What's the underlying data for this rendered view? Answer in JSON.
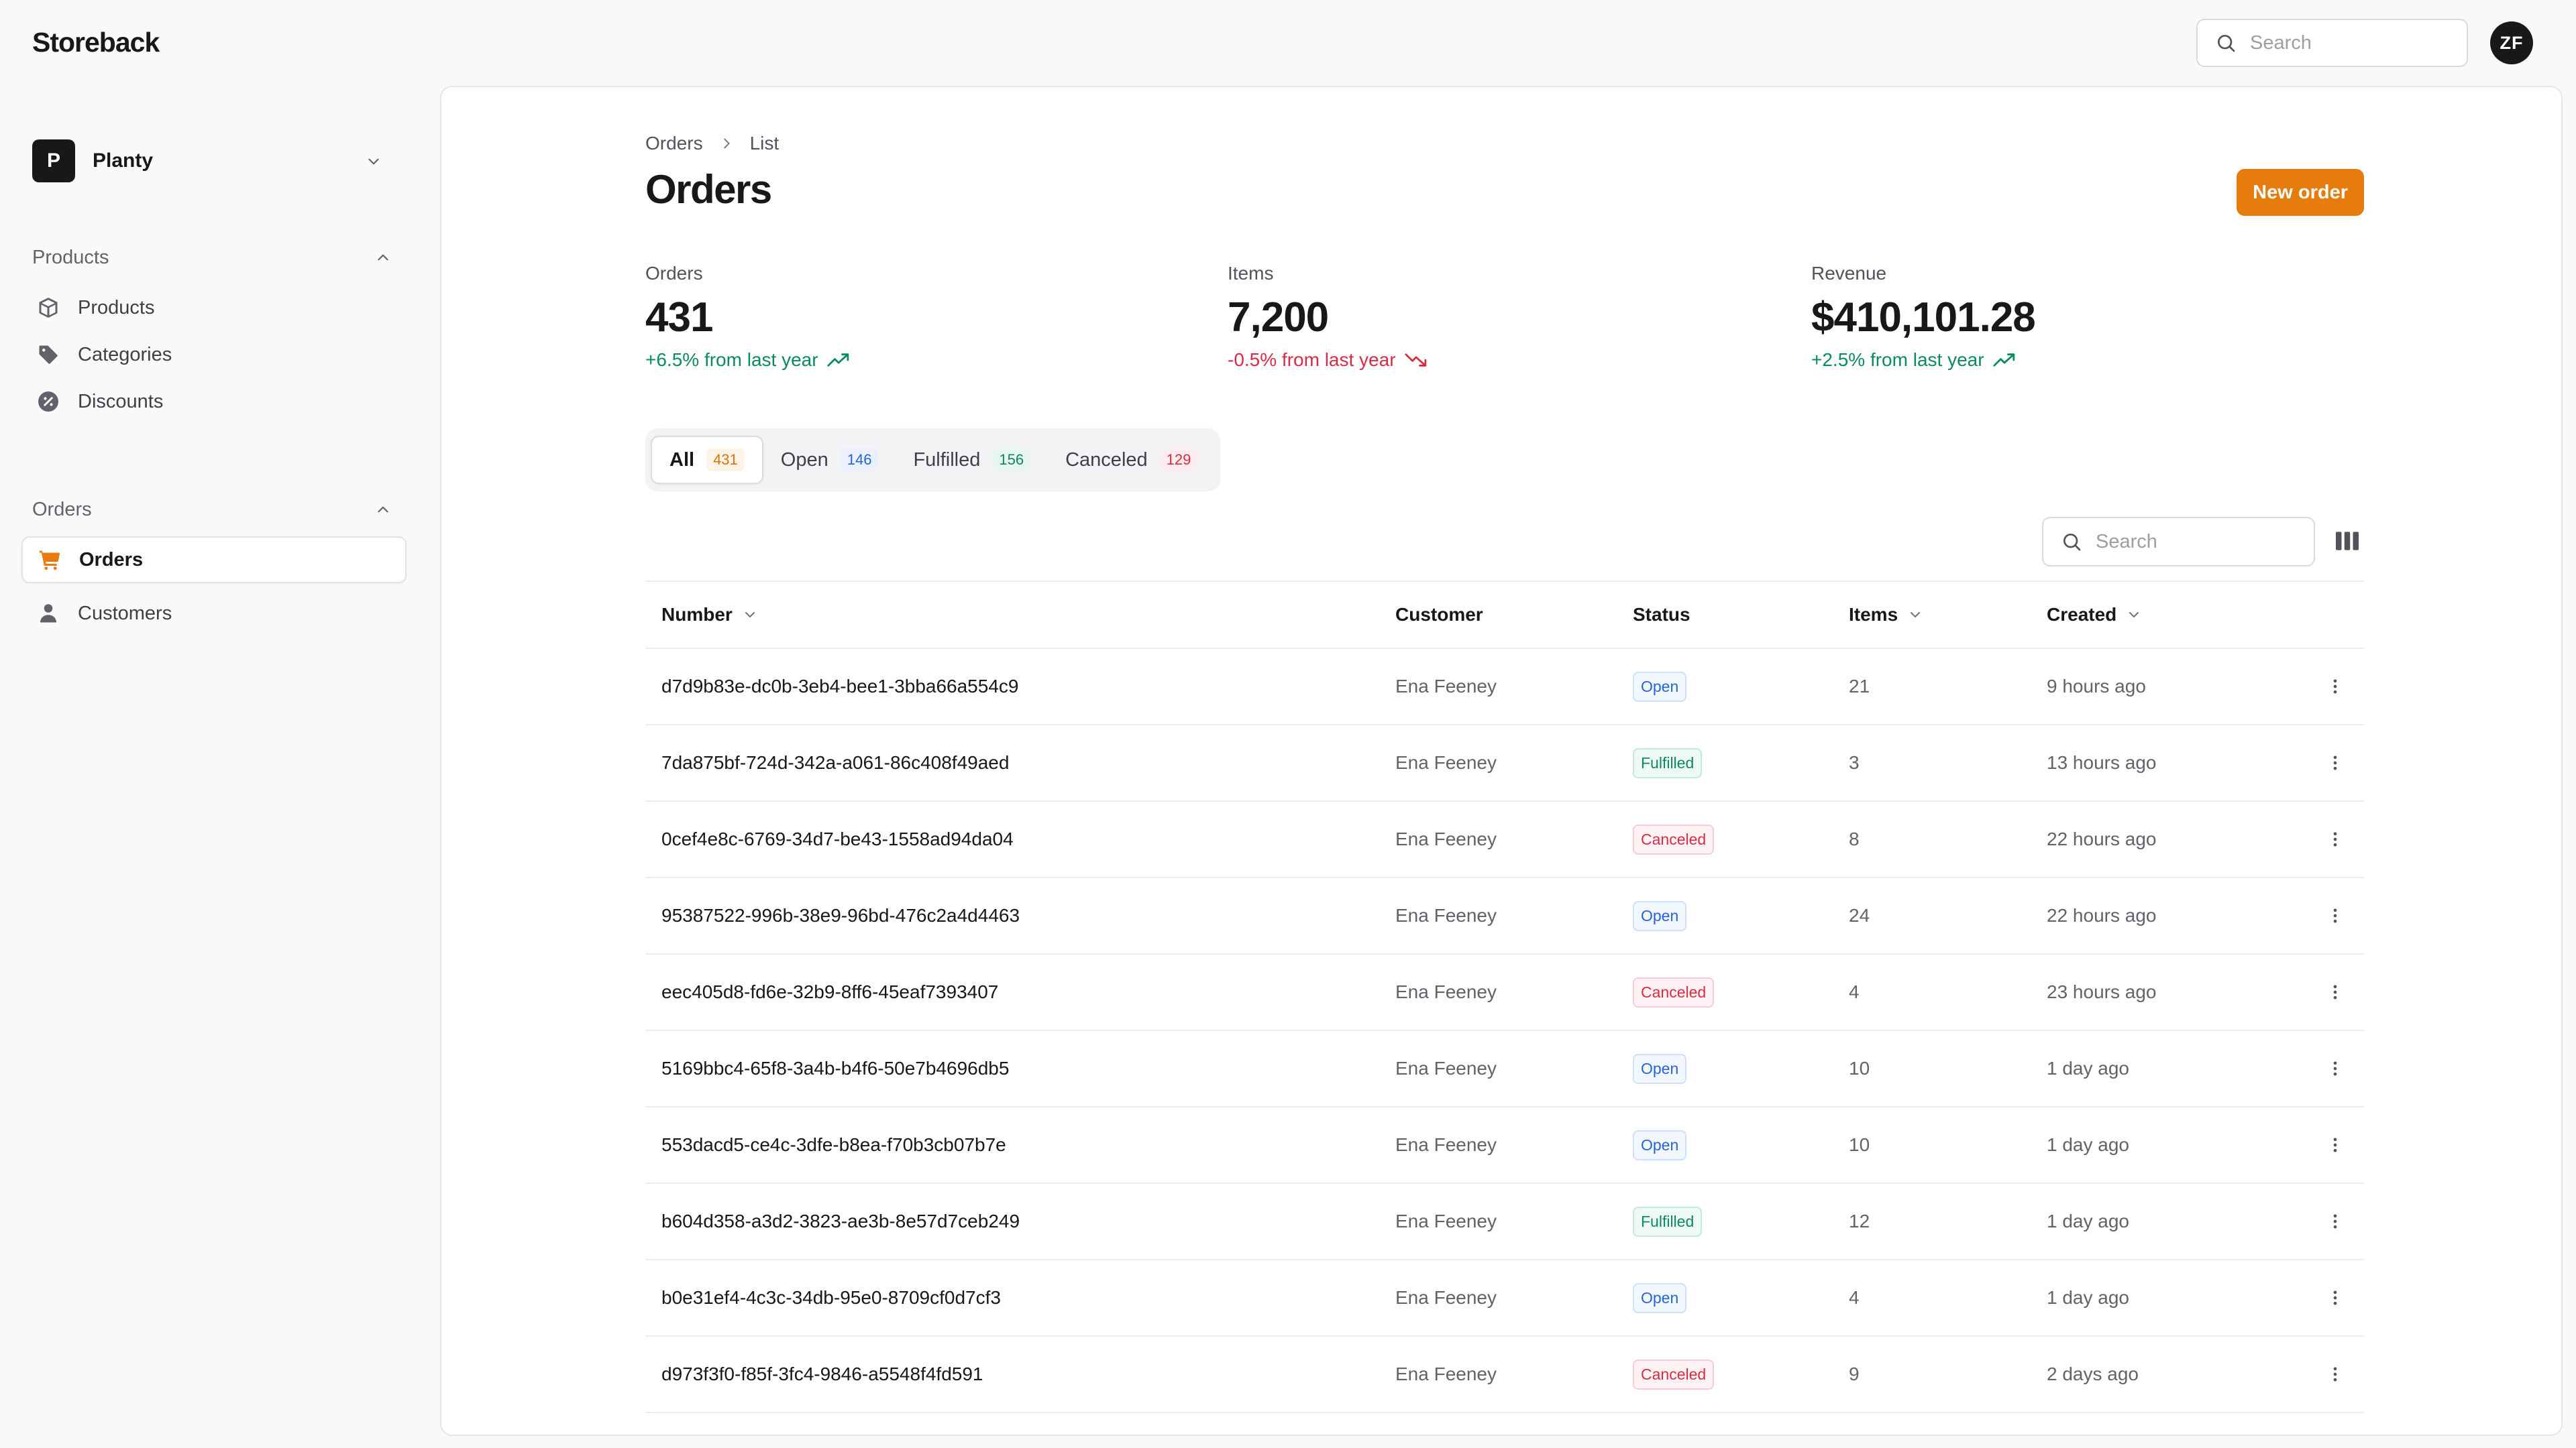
{
  "app": {
    "brand": "Storeback"
  },
  "header": {
    "search_placeholder": "Search",
    "user_initials": "ZF"
  },
  "store": {
    "badge": "P",
    "name": "Planty"
  },
  "sidebar": {
    "sections": [
      {
        "heading": "Products",
        "items": [
          {
            "label": "Products",
            "icon": "box-icon"
          },
          {
            "label": "Categories",
            "icon": "tag-icon"
          },
          {
            "label": "Discounts",
            "icon": "discount-icon"
          }
        ]
      },
      {
        "heading": "Orders",
        "items": [
          {
            "label": "Orders",
            "icon": "cart-icon",
            "active": true
          },
          {
            "label": "Customers",
            "icon": "user-icon"
          }
        ]
      }
    ]
  },
  "page": {
    "breadcrumb": [
      "Orders",
      "List"
    ],
    "title": "Orders",
    "new_order_label": "New order"
  },
  "stats": [
    {
      "label": "Orders",
      "value": "431",
      "trend": "+6.5% from last year",
      "direction": "up"
    },
    {
      "label": "Items",
      "value": "7,200",
      "trend": "-0.5% from last year",
      "direction": "down"
    },
    {
      "label": "Revenue",
      "value": "$410,101.28",
      "trend": "+2.5% from last year",
      "direction": "up"
    }
  ],
  "tabs": [
    {
      "label": "All",
      "count": "431",
      "active": true
    },
    {
      "label": "Open",
      "count": "146"
    },
    {
      "label": "Fulfilled",
      "count": "156"
    },
    {
      "label": "Canceled",
      "count": "129"
    }
  ],
  "table": {
    "search_placeholder": "Search",
    "columns": {
      "number": "Number",
      "customer": "Customer",
      "status": "Status",
      "items": "Items",
      "created": "Created"
    },
    "rows": [
      {
        "number": "d7d9b83e-dc0b-3eb4-bee1-3bba66a554c9",
        "customer": "Ena Feeney",
        "status": "Open",
        "items": "21",
        "created": "9 hours ago"
      },
      {
        "number": "7da875bf-724d-342a-a061-86c408f49aed",
        "customer": "Ena Feeney",
        "status": "Fulfilled",
        "items": "3",
        "created": "13 hours ago"
      },
      {
        "number": "0cef4e8c-6769-34d7-be43-1558ad94da04",
        "customer": "Ena Feeney",
        "status": "Canceled",
        "items": "8",
        "created": "22 hours ago"
      },
      {
        "number": "95387522-996b-38e9-96bd-476c2a4d4463",
        "customer": "Ena Feeney",
        "status": "Open",
        "items": "24",
        "created": "22 hours ago"
      },
      {
        "number": "eec405d8-fd6e-32b9-8ff6-45eaf7393407",
        "customer": "Ena Feeney",
        "status": "Canceled",
        "items": "4",
        "created": "23 hours ago"
      },
      {
        "number": "5169bbc4-65f8-3a4b-b4f6-50e7b4696db5",
        "customer": "Ena Feeney",
        "status": "Open",
        "items": "10",
        "created": "1 day ago"
      },
      {
        "number": "553dacd5-ce4c-3dfe-b8ea-f70b3cb07b7e",
        "customer": "Ena Feeney",
        "status": "Open",
        "items": "10",
        "created": "1 day ago"
      },
      {
        "number": "b604d358-a3d2-3823-ae3b-8e57d7ceb249",
        "customer": "Ena Feeney",
        "status": "Fulfilled",
        "items": "12",
        "created": "1 day ago"
      },
      {
        "number": "b0e31ef4-4c3c-34db-95e0-8709cf0d7cf3",
        "customer": "Ena Feeney",
        "status": "Open",
        "items": "4",
        "created": "1 day ago"
      },
      {
        "number": "d973f3f0-f85f-3fc4-9846-a5548f4fd591",
        "customer": "Ena Feeney",
        "status": "Canceled",
        "items": "9",
        "created": "2 days ago"
      }
    ]
  },
  "colors": {
    "accent": "#e57c0c",
    "trend_up": "#0a8b5d",
    "trend_down": "#d92c43",
    "status_open": "#2764d8",
    "status_fulfilled": "#0c8a5c",
    "status_canceled": "#d92c43"
  }
}
